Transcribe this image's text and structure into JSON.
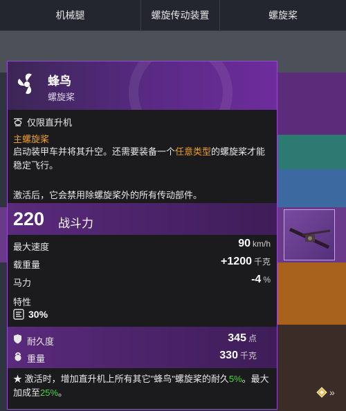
{
  "tabs": [
    "机械腿",
    "螺旋传动装置",
    "螺旋桨"
  ],
  "panel": {
    "title": "蜂鸟",
    "subtitle": "螺旋桨",
    "restriction": "仅限直升机",
    "section_heading": "主螺旋桨",
    "desc_part1": "启动装甲车并将其升空。还需要装备一个",
    "desc_highlight": "任意类型",
    "desc_part2": "的螺旋桨才能稳定飞行。",
    "desc_active": "激活后，它会禁用除螺旋桨外的所有传动部件。",
    "power_value": "220",
    "power_label": "战斗力",
    "stats": [
      {
        "label": "最大速度",
        "value": "90",
        "unit": "km/h"
      },
      {
        "label": "载重量",
        "value": "+1200",
        "unit": "千克"
      },
      {
        "label": "马力",
        "value": "-4",
        "unit": "%"
      }
    ],
    "trait_label": "特性",
    "trait_value": "30%",
    "durability": {
      "label": "耐久度",
      "value": "345",
      "unit": "点"
    },
    "weight": {
      "label": "重量",
      "value": "330",
      "unit": "千克"
    },
    "note_star": "★",
    "note_part1": "激活时，增加直升机上所有其它\"蜂鸟\"螺旋桨的耐久",
    "note_pct1": "5%",
    "note_part2": "。最大加成至",
    "note_pct2": "25%",
    "note_part3": "。"
  },
  "nav_arrows": "»",
  "colors": {
    "accent_purple": "#9a4ad0",
    "highlight_orange": "#f0a020",
    "bonus_green": "#48d83e"
  }
}
